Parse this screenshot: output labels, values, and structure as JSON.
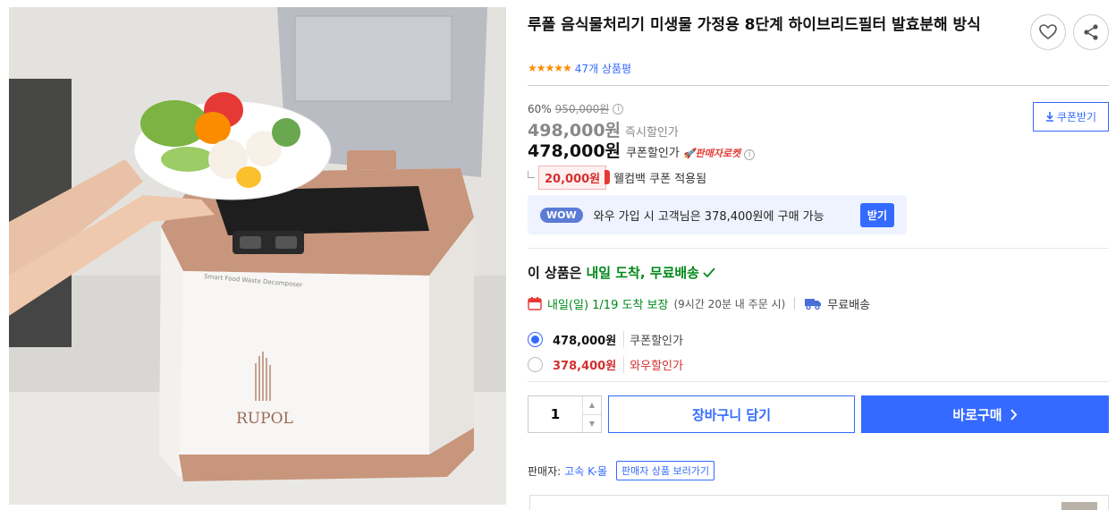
{
  "product": {
    "title": "루폴 음식물처리기 미생물 가정용 8단계 하이브리드필터 발효분해 방식",
    "rating_stars": "★★★★★",
    "review_count": "47개 상품평",
    "image_brand": "RUPOL",
    "image_subtitle": "Smart Food Waste Decomposer"
  },
  "pricing": {
    "discount_rate": "60%",
    "original_price": "950,000원",
    "instant_price": "498,000원",
    "instant_label": "즉시할인가",
    "coupon_price": "478,000원",
    "coupon_label": "쿠폰할인가",
    "rocket_badge": "🚀판매자로켓",
    "coupon_button": "쿠폰받기",
    "welcome_amount": "20,000원",
    "welcome_text": "웰컴백 쿠폰 적용됨"
  },
  "wow": {
    "badge": "WOW",
    "text": "와우 가입 시 고객님은 378,400원에 구매 가능",
    "button": "받기"
  },
  "delivery": {
    "heading": "이 상품은",
    "heading_highlight": "내일 도착, 무료배송",
    "arrival": "내일(일) 1/19 도착 보장",
    "arrival_note": "(9시간 20분 내 주문 시)",
    "free_shipping": "무료배송"
  },
  "options": [
    {
      "price": "478,000원",
      "label": "쿠폰할인가",
      "selected": true
    },
    {
      "price": "378,400원",
      "label": "와우할인가",
      "selected": false
    }
  ],
  "purchase": {
    "quantity": "1",
    "cart_button": "장바구니 담기",
    "buy_button": "바로구매"
  },
  "seller": {
    "label": "판매자:",
    "name": "고속 K-몰",
    "link": "판매자 상품 보러가기"
  },
  "colors": {
    "accent": "#346aff",
    "green": "#00891a",
    "red": "#d32f2f",
    "star": "#ff8a00"
  }
}
